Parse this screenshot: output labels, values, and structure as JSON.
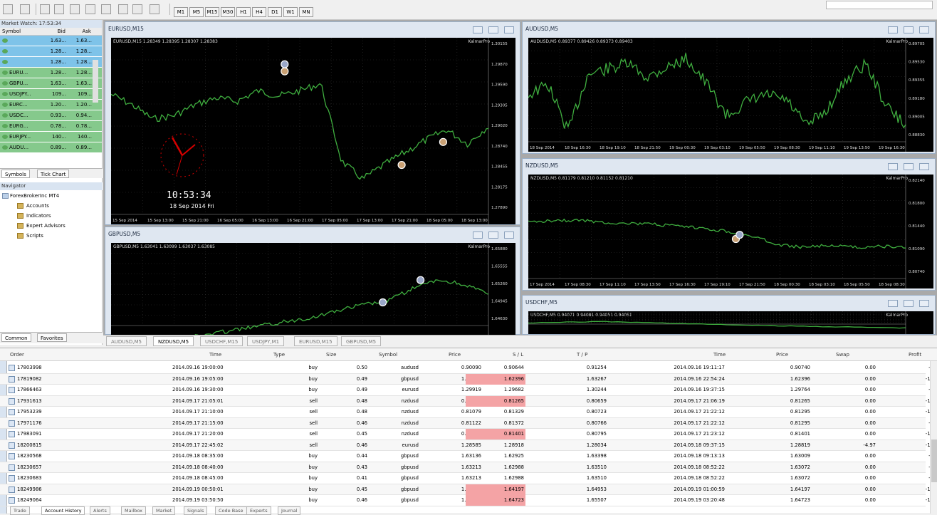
{
  "toolbar": {
    "timeframes": [
      "M1",
      "M5",
      "M15",
      "M30",
      "H1",
      "H4",
      "D1",
      "W1",
      "MN"
    ]
  },
  "market_watch": {
    "title": "Market Watch: 17:53:34",
    "headers": {
      "symbol": "Symbol",
      "bid": "Bid",
      "ask": "Ask"
    },
    "rows": [
      {
        "symbol": "",
        "bid": "1.63...",
        "ask": "1.63...",
        "color": "#7ec3e9"
      },
      {
        "symbol": "",
        "bid": "1.28...",
        "ask": "1.28...",
        "color": "#7ec3e9"
      },
      {
        "symbol": "",
        "bid": "1.28...",
        "ask": "1.28...",
        "color": "#7ec3e9"
      },
      {
        "symbol": "EURU...",
        "bid": "1.28...",
        "ask": "1.28...",
        "color": "#85c98c"
      },
      {
        "symbol": "GBPU...",
        "bid": "1.63...",
        "ask": "1.63...",
        "color": "#85c98c"
      },
      {
        "symbol": "USDJPY...",
        "bid": "109...",
        "ask": "109...",
        "color": "#85c98c"
      },
      {
        "symbol": "EURC...",
        "bid": "1.20...",
        "ask": "1.20...",
        "color": "#85c98c"
      },
      {
        "symbol": "USDC...",
        "bid": "0.93...",
        "ask": "0.94...",
        "color": "#85c98c"
      },
      {
        "symbol": "EURG...",
        "bid": "0.78...",
        "ask": "0.78...",
        "color": "#85c98c"
      },
      {
        "symbol": "EURJPY...",
        "bid": "140...",
        "ask": "140...",
        "color": "#85c98c"
      },
      {
        "symbol": "AUDU...",
        "bid": "0.89...",
        "ask": "0.89...",
        "color": "#85c98c"
      }
    ],
    "tabs": [
      "Symbols",
      "Tick Chart"
    ]
  },
  "navigator": {
    "title": "Navigator",
    "root": "ForexBrokerInc MT4",
    "items": [
      "Accounts",
      "Indicators",
      "Expert Advisors",
      "Scripts"
    ],
    "tabs": [
      "Common",
      "Favorites"
    ]
  },
  "charts": [
    {
      "title": "EURUSD,M15",
      "info": "EURUSD,M15  1.28349 1.28395 1.28307 1.28383",
      "badge": "KalmarPro",
      "price_labels": [
        "1.30155",
        "1.29870",
        "1.29590",
        "1.29305",
        "1.29020",
        "1.28740",
        "1.28455",
        "1.28175",
        "1.27890"
      ],
      "time_labels": [
        "15 Sep 2014",
        "15 Sep 13:00",
        "15 Sep 21:00",
        "16 Sep 05:00",
        "16 Sep 13:00",
        "16 Sep 21:00",
        "17 Sep 05:00",
        "17 Sep 13:00",
        "17 Sep 21:00",
        "18 Sep 05:00",
        "18 Sep 13:00"
      ],
      "clock_time": "10:53:34",
      "clock_date": "18 Sep 2014 Fri"
    },
    {
      "title": "AUDUSD,M5",
      "info": "AUDUSD,M5  0.89377 0.89426 0.89373 0.89403",
      "badge": "KalmarPro",
      "price_labels": [
        "0.89705",
        "0.89530",
        "0.89355",
        "0.89180",
        "0.89005",
        "0.88830"
      ],
      "time_labels": [
        "18 Sep 2014",
        "18 Sep 16:30",
        "18 Sep 19:10",
        "18 Sep 21:50",
        "19 Sep 00:30",
        "19 Sep 03:10",
        "19 Sep 05:50",
        "19 Sep 08:30",
        "19 Sep 11:10",
        "19 Sep 13:50",
        "19 Sep 16:30"
      ]
    },
    {
      "title": "NZDUSD,M5",
      "info": "NZDUSD,M5  0.81179 0.81210 0.81152 0.81210",
      "badge": "KalmarPro",
      "price_labels": [
        "0.82140",
        "0.81800",
        "0.81440",
        "0.81090",
        "0.80740"
      ],
      "time_labels": [
        "17 Sep 2014",
        "17 Sep 08:30",
        "17 Sep 11:10",
        "17 Sep 13:50",
        "17 Sep 16:30",
        "17 Sep 19:10",
        "17 Sep 21:50",
        "18 Sep 00:30",
        "18 Sep 03:10",
        "18 Sep 05:50",
        "18 Sep 08:30"
      ]
    },
    {
      "title": "GBPUSD,M5",
      "info": "GBPUSD,M5  1.63041 1.63099 1.63037 1.63085",
      "badge": "KalmarPro",
      "price_labels": [
        "1.65880",
        "1.65555",
        "1.65260",
        "1.64945",
        "1.64630"
      ],
      "time_labels": []
    },
    {
      "title": "USDCHF,M5",
      "info": "USDCHF,M5  0.94071 0.94081 0.94051 0.94051",
      "badge": "KalmarPro",
      "price_labels": [],
      "time_labels": []
    }
  ],
  "chart_tabs": [
    "AUDUSD,M5",
    "NZDUSD,M5",
    "USDCHF,M15",
    "USDJPY,M1",
    "EURUSD,M15",
    "GBPUSD,M5"
  ],
  "terminal": {
    "headers": {
      "order": "Order",
      "time": "Time",
      "type": "Type",
      "size": "Size",
      "symbol": "Symbol",
      "price": "Price",
      "sl": "S / L",
      "tp": "T / P",
      "ctime": "Time",
      "cprice": "Price",
      "swap": "Swap",
      "profit": "Profit"
    },
    "rows": [
      {
        "order": "17803998",
        "time": "2014.09.16 19:00:00",
        "type": "buy",
        "size": "0.50",
        "symbol": "audusd",
        "price": "0.90090",
        "sl": "0.90644",
        "tp": "0.91254",
        "ctime": "2014.09.16 19:11:17",
        "cprice": "0.90740",
        "swap": "0.00",
        "profit": "-75.00",
        "hl": false
      },
      {
        "order": "17819082",
        "time": "2014.09.16 19:05:00",
        "type": "buy",
        "size": "0.49",
        "symbol": "gbpusd",
        "price": "1.62725",
        "sl": "1.62396",
        "tp": "1.63267",
        "ctime": "2014.09.16 22:54:24",
        "cprice": "1.62396",
        "swap": "0.00",
        "profit": "-161.21",
        "hl": true
      },
      {
        "order": "17866463",
        "time": "2014.09.16 19:30:00",
        "type": "buy",
        "size": "0.49",
        "symbol": "eurusd",
        "price": "1.29919",
        "sl": "1.29682",
        "tp": "1.30244",
        "ctime": "2014.09.16 19:37:15",
        "cprice": "1.29764",
        "swap": "0.00",
        "profit": "-74.40",
        "hl": false
      },
      {
        "order": "17931613",
        "time": "2014.09.17 21:05:01",
        "type": "sell",
        "size": "0.48",
        "symbol": "nzdusd",
        "price": "0.81015",
        "sl": "0.81265",
        "tp": "0.80659",
        "ctime": "2014.09.17 21:06:19",
        "cprice": "0.81265",
        "swap": "0.00",
        "profit": "-120.00",
        "hl": true
      },
      {
        "order": "17953239",
        "time": "2014.09.17 21:10:00",
        "type": "sell",
        "size": "0.48",
        "symbol": "nzdusd",
        "price": "0.81079",
        "sl": "0.81329",
        "tp": "0.80723",
        "ctime": "2014.09.17 21:22:12",
        "cprice": "0.81295",
        "swap": "0.00",
        "profit": "-103.68",
        "hl": false
      },
      {
        "order": "17971176",
        "time": "2014.09.17 21:15:00",
        "type": "sell",
        "size": "0.46",
        "symbol": "nzdusd",
        "price": "0.81122",
        "sl": "0.81372",
        "tp": "0.80766",
        "ctime": "2014.09.17 21:22:12",
        "cprice": "0.81295",
        "swap": "0.00",
        "profit": "-79.58",
        "hl": false
      },
      {
        "order": "17983091",
        "time": "2014.09.17 21:20:00",
        "type": "sell",
        "size": "0.45",
        "symbol": "nzdusd",
        "price": "0.81151",
        "sl": "0.81401",
        "tp": "0.80795",
        "ctime": "2014.09.17 21:23:12",
        "cprice": "0.81401",
        "swap": "0.00",
        "profit": "-112.50",
        "hl": true
      },
      {
        "order": "18200815",
        "time": "2014.09.17 22:45:02",
        "type": "sell",
        "size": "0.46",
        "symbol": "eurusd",
        "price": "1.28585",
        "sl": "1.28918",
        "tp": "1.28034",
        "ctime": "2014.09.18 09:37:15",
        "cprice": "1.28819",
        "swap": "-4.97",
        "profit": "-107.64",
        "hl": false
      },
      {
        "order": "18230568",
        "time": "2014.09.18 08:35:00",
        "type": "buy",
        "size": "0.44",
        "symbol": "gbpusd",
        "price": "1.63136",
        "sl": "1.62925",
        "tp": "1.63398",
        "ctime": "2014.09.18 09:13:13",
        "cprice": "1.63009",
        "swap": "0.00",
        "profit": "-55.88",
        "hl": false
      },
      {
        "order": "18230657",
        "time": "2014.09.18 08:40:00",
        "type": "buy",
        "size": "0.43",
        "symbol": "gbpusd",
        "price": "1.63213",
        "sl": "1.62988",
        "tp": "1.63510",
        "ctime": "2014.09.18 08:52:22",
        "cprice": "1.63072",
        "swap": "0.00",
        "profit": "-60.63",
        "hl": false
      },
      {
        "order": "18230683",
        "time": "2014.09.18 08:45:00",
        "type": "buy",
        "size": "0.41",
        "symbol": "gbpusd",
        "price": "1.63213",
        "sl": "1.62988",
        "tp": "1.63510",
        "ctime": "2014.09.18 08:52:22",
        "cprice": "1.63072",
        "swap": "0.00",
        "profit": "-57.81",
        "hl": false
      },
      {
        "order": "18249986",
        "time": "2014.09.19 00:50:01",
        "type": "buy",
        "size": "0.45",
        "symbol": "gbpusd",
        "price": "1.64502",
        "sl": "1.64197",
        "tp": "1.64953",
        "ctime": "2014.09.19 01:00:59",
        "cprice": "1.64197",
        "swap": "0.00",
        "profit": "-137.25",
        "hl": true
      },
      {
        "order": "18249064",
        "time": "2014.09.19 03:50:50",
        "type": "buy",
        "size": "0.46",
        "symbol": "gbpusd",
        "price": "1.65050",
        "sl": "1.64723",
        "tp": "1.65507",
        "ctime": "2014.09.19 03:20:48",
        "cprice": "1.64723",
        "swap": "0.00",
        "profit": "-150.42",
        "hl": true
      }
    ],
    "tabs": [
      "Trade",
      "Account History",
      "Alerts",
      "Mailbox",
      "Market",
      "Signals",
      "Code Base",
      "Experts",
      "Journal"
    ]
  },
  "colors": {
    "chart_bg": "#000000",
    "candle": "#3fae3f",
    "sl_highlight": "#f4a3a5",
    "clock": "#d40000"
  }
}
